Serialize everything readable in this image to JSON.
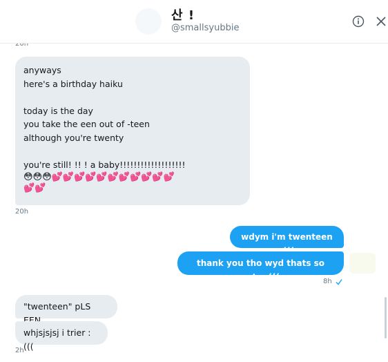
{
  "header": {
    "name": "산 !",
    "handle": "@smallsyubbie"
  },
  "messages": {
    "top_timestamp": "20h",
    "haiku": {
      "lines": [
        "anyways",
        "here's a birthday haiku",
        "",
        "today is the day",
        "you take the een out of -teen",
        "although you're twenty",
        "",
        "you're still! !! ! a baby!!!!!!!!!!!!!!!!!!!"
      ],
      "emoji_line_1": "😳😳😳💕💕💕💕💕💕💕💕💕💕💕",
      "emoji_line_2": "💕💕",
      "timestamp": "20h"
    },
    "sent_1": "wdym i'm twenteen :(((",
    "sent_2": "thank you tho wyd thats so cute :(((",
    "sent_timestamp": "8h",
    "recv_1": "\"twenteen\" pLS EEN",
    "recv_2": "whjsjsjsj i trier : (((",
    "recv_timestamp": "2h"
  },
  "icons": {
    "info": "info-icon",
    "close": "close-icon",
    "read_receipt": "check-icon"
  },
  "colors": {
    "sent_bubble": "#1da1f2",
    "received_bubble": "#e6ecf0",
    "muted_text": "#657786"
  }
}
